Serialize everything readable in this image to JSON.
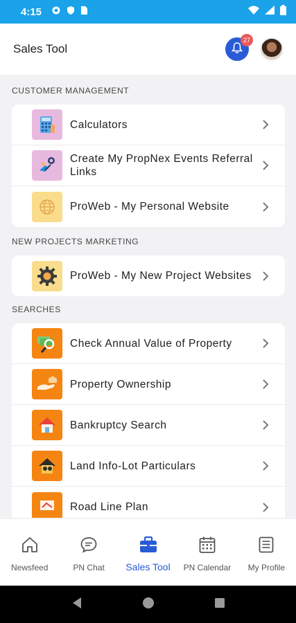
{
  "status_bar": {
    "time": "4:15"
  },
  "header": {
    "title": "Sales Tool",
    "notification_count": "27"
  },
  "sections": [
    {
      "title": "CUSTOMER MANAGEMENT",
      "items": [
        {
          "label": "Calculators",
          "icon": "calculator-icon"
        },
        {
          "label": "Create My PropNex Events Referral Links",
          "icon": "referral-link-icon"
        },
        {
          "label": "ProWeb - My Personal Website",
          "icon": "globe-icon"
        }
      ]
    },
    {
      "title": "NEW PROJECTS MARKETING",
      "items": [
        {
          "label": "ProWeb - My New Project Websites",
          "icon": "gear-icon"
        }
      ]
    },
    {
      "title": "SEARCHES",
      "items": [
        {
          "label": "Check Annual Value of Property",
          "icon": "money-search-icon"
        },
        {
          "label": "Property Ownership",
          "icon": "hand-house-icon"
        },
        {
          "label": "Bankruptcy Search",
          "icon": "house-icon"
        },
        {
          "label": "Land Info-Lot Particulars",
          "icon": "land-info-icon"
        },
        {
          "label": "Road Line Plan",
          "icon": "road-plan-icon"
        }
      ]
    }
  ],
  "bottom_nav": [
    {
      "label": "Newsfeed",
      "icon": "home-icon"
    },
    {
      "label": "PN Chat",
      "icon": "chat-icon"
    },
    {
      "label": "Sales Tool",
      "icon": "briefcase-icon",
      "active": true
    },
    {
      "label": "PN Calendar",
      "icon": "calendar-icon"
    },
    {
      "label": "My Profile",
      "icon": "profile-icon"
    }
  ],
  "colors": {
    "status_bar": "#1aa3e8",
    "accent": "#2a5bd7",
    "badge": "#e85a5a",
    "search_icon_bg": "#f58512"
  }
}
